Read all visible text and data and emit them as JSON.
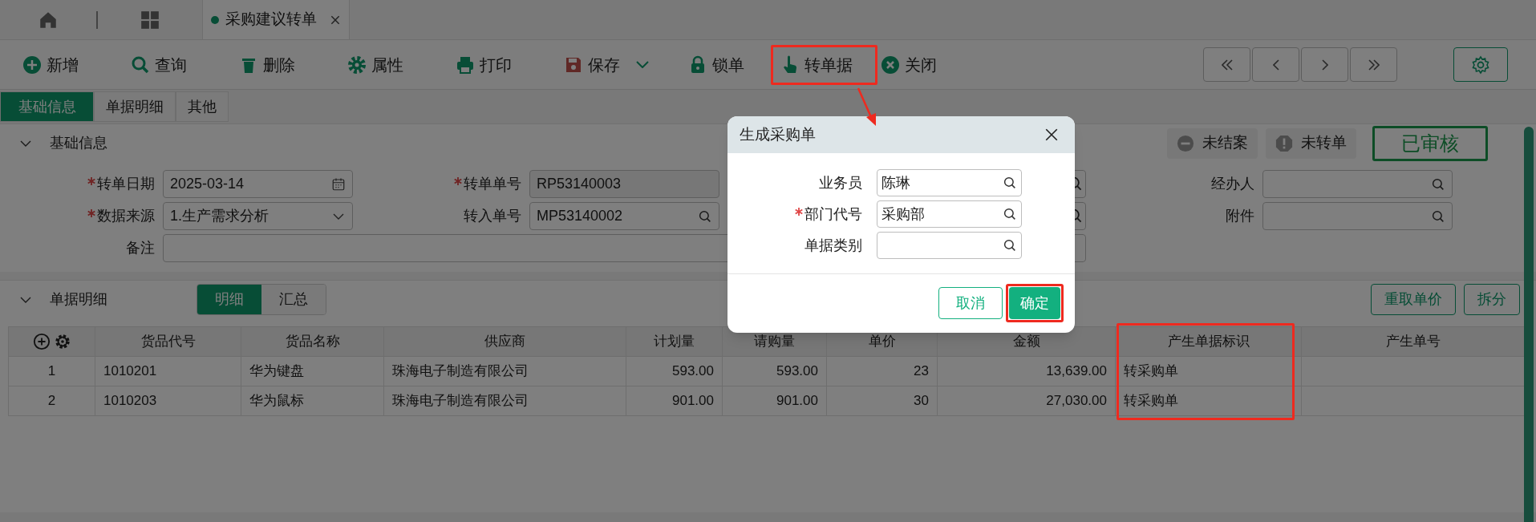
{
  "tab_bar": {
    "tabs": [
      {
        "label": "采购建议转单",
        "selected": true
      }
    ]
  },
  "toolbar": {
    "buttons": [
      {
        "label": "新增",
        "dropdown": false,
        "highlighted": false
      },
      {
        "label": "查询",
        "dropdown": false,
        "highlighted": false
      },
      {
        "label": "删除",
        "dropdown": false,
        "highlighted": false
      },
      {
        "label": "属性",
        "dropdown": false,
        "highlighted": false
      },
      {
        "label": "打印",
        "dropdown": false,
        "highlighted": false
      },
      {
        "label": "保存",
        "dropdown": true,
        "highlighted": false
      },
      {
        "label": "锁单",
        "dropdown": false,
        "highlighted": false
      },
      {
        "label": "转单据",
        "dropdown": false,
        "highlighted": true
      },
      {
        "label": "关闭",
        "dropdown": false,
        "highlighted": false
      }
    ]
  },
  "section_tabs": [
    {
      "label": "基础信息",
      "selected": true
    },
    {
      "label": "单据明细",
      "selected": false
    },
    {
      "label": "其他",
      "selected": false
    }
  ],
  "basic_info": {
    "title": "基础信息",
    "expanded": true,
    "badges": [
      {
        "kind": "closed",
        "label": "未结案"
      },
      {
        "kind": "transfer",
        "label": "未转单"
      },
      {
        "kind": "approved",
        "label": "已审核"
      }
    ],
    "fields": [
      {
        "label": "转单日期",
        "required": true,
        "kind": "date",
        "value": "2025-03-14"
      },
      {
        "label": "转单单号",
        "required": true,
        "kind": "readonly",
        "value": "RP53140003"
      },
      {
        "kind": "lookup",
        "required": false
      },
      {
        "label": "经办人",
        "required": false,
        "kind": "lookup"
      },
      {
        "label": "数据来源",
        "required": true,
        "kind": "select",
        "value": "1.生产需求分析"
      },
      {
        "label": "转入单号",
        "required": false,
        "kind": "lookup",
        "value": "MP53140002"
      },
      {
        "kind": "lookup",
        "required": false
      },
      {
        "label": "附件",
        "required": false,
        "kind": "lookup"
      },
      {
        "label": "备注",
        "required": false,
        "kind": "wide"
      }
    ]
  },
  "detail": {
    "title": "单据明细",
    "expanded": true,
    "view_tabs": [
      {
        "label": "明细",
        "selected": true
      },
      {
        "label": "汇总",
        "selected": false
      }
    ],
    "buttons": [
      "重取单价",
      "拆分"
    ],
    "table": {
      "columns": [
        {
          "kind": "row_number",
          "highlighted": false
        },
        {
          "label": "货品代号",
          "highlighted": false
        },
        {
          "label": "货品名称",
          "highlighted": false
        },
        {
          "label": "供应商",
          "highlighted": false
        },
        {
          "label": "计划量",
          "highlighted": false
        },
        {
          "label": "请购量",
          "highlighted": false
        },
        {
          "label": "单价",
          "highlighted": false
        },
        {
          "label": "金额",
          "highlighted": false
        },
        {
          "label": "产生单据标识",
          "highlighted": true
        },
        {
          "label": "产生单号",
          "highlighted": false
        }
      ],
      "rows": [
        [
          "1",
          "1010201",
          "华为键盘",
          "珠海电子制造有限公司",
          "593.00",
          "593.00",
          "23",
          "13,639.00",
          "转采购单",
          ""
        ],
        [
          "2",
          "1010203",
          "华为鼠标",
          "珠海电子制造有限公司",
          "901.00",
          "901.00",
          "30",
          "27,030.00",
          "转采购单",
          ""
        ]
      ]
    }
  },
  "dialog": {
    "title": "生成采购单",
    "fields": [
      {
        "label": "业务员",
        "required": false,
        "value": "陈琳"
      },
      {
        "label": "部门代号",
        "required": true,
        "value": "采购部"
      },
      {
        "label": "单据类别",
        "required": false
      }
    ],
    "buttons": [
      {
        "label": "取消",
        "kind": "secondary",
        "highlighted": false
      },
      {
        "label": "确定",
        "kind": "primary",
        "highlighted": true
      }
    ]
  }
}
